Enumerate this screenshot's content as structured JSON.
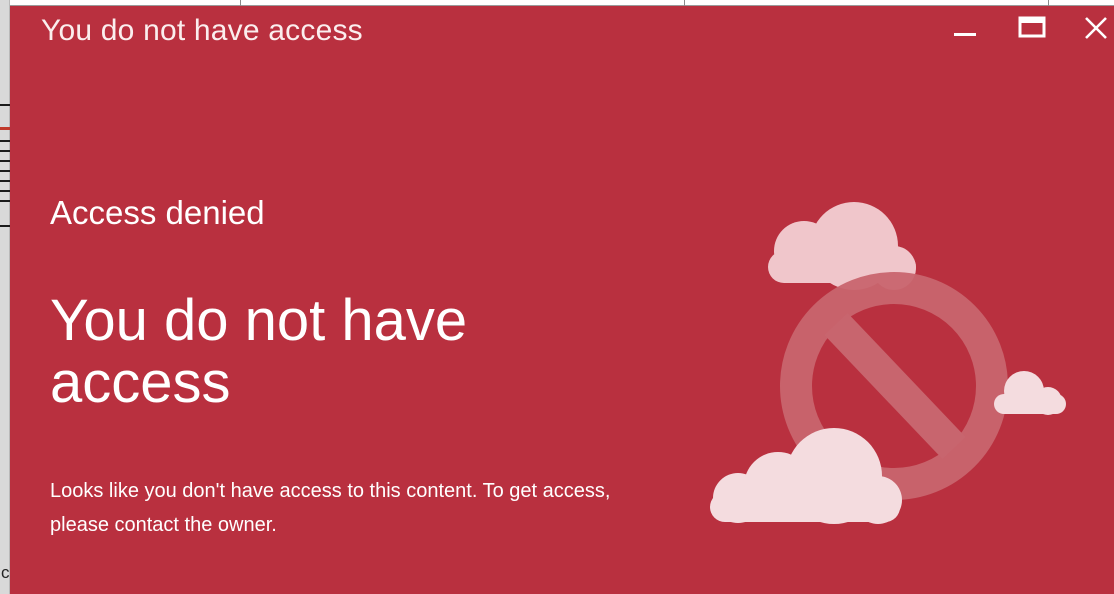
{
  "window": {
    "title": "You do not have access",
    "controls": [
      "minimize",
      "maximize",
      "close"
    ]
  },
  "content": {
    "heading_small": "Access denied",
    "heading_big": "You do not have access",
    "message": "Looks like you don't have access to this content. To get access, please contact the owner."
  },
  "background": {
    "corner_text": "c"
  },
  "icons": {
    "illustration": "no-access-clouds-illustration",
    "minimize": "minimize-icon",
    "maximize": "maximize-icon",
    "close": "close-icon"
  },
  "colors": {
    "dialog_background": "#b9303f",
    "text": "#ffffff"
  }
}
